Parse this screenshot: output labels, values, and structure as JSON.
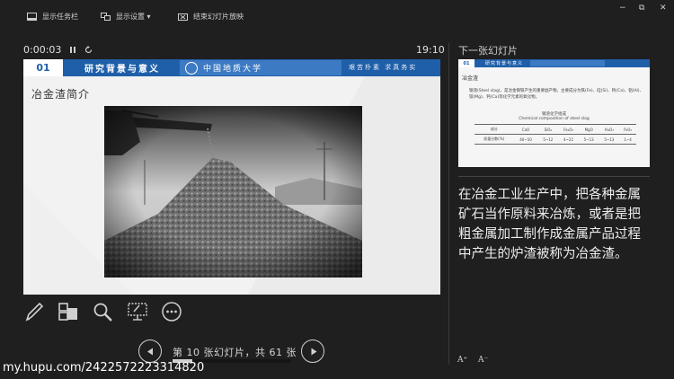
{
  "toolbar": {
    "show_taskbar": "显示任务栏",
    "display_settings": "显示设置 ▾",
    "end_show": "结束幻灯片放映"
  },
  "window_controls": {
    "minimize": "−",
    "restore": "⧉",
    "close": "✕"
  },
  "timer": {
    "elapsed": "0:00:03",
    "clock": "19:10"
  },
  "next_slide_label": "下一张幻灯片",
  "current_slide": {
    "number": "01",
    "header_title": "研究背景与意义",
    "logo_text": "中国地质大学",
    "motto": "艰苦朴素  求真务实",
    "subtitle": "冶金渣简介",
    "photo_icon": "slag-pile-photo"
  },
  "next_slide": {
    "number": "01",
    "header_title": "研究背景与意义",
    "subtitle": "冶金渣",
    "paragraph": "钢渣(Steel slag)，是冶金钢铁产生的重要副产物。主要成分为铁(Fe)、硅(Si)、钙(Ca)、铝(Al)、镁(Mg)、钙(Ca)等化学元素的氧化物。",
    "table_caption_cn": "钢渣化学组成",
    "table_caption_en": "Chemical composition of steel slag",
    "table_headers": [
      "成分",
      "CaO",
      "SiO₂",
      "Fe₂O₃",
      "MgO",
      "Al₂O₃",
      "P₂O₅"
    ],
    "table_row": [
      "质量分数(%)",
      "40~50",
      "5~12",
      "4~22",
      "5~13",
      "5~13",
      "1~4"
    ]
  },
  "notes": "在冶金工业生产中，把各种金属矿石当作原料来冶炼，或者是把粗金属加工制作成金属产品过程中产生的炉渣被称为冶金渣。",
  "tools": [
    "pen-icon",
    "multi-slide-icon",
    "zoom-icon",
    "pointer-screen-icon",
    "more-options-icon"
  ],
  "navigation": {
    "counter": "第 10 张幻灯片，共 61 张",
    "progress": 0.164
  },
  "font_controls": {
    "increase": "A⁺",
    "decrease": "A⁻"
  },
  "watermark": "my.hupu.com/2422572223314820"
}
